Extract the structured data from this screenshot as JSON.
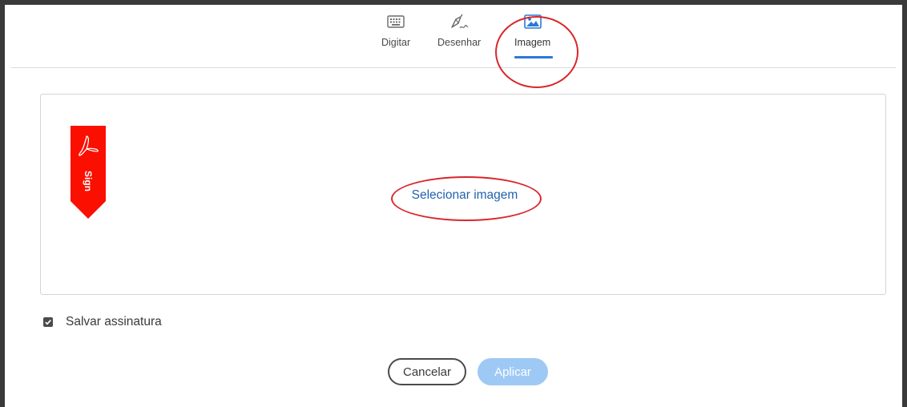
{
  "tabs": [
    {
      "label": "Digitar",
      "icon": "keyboard-icon"
    },
    {
      "label": "Desenhar",
      "icon": "pen-draw-icon"
    },
    {
      "label": "Imagem",
      "icon": "image-icon"
    }
  ],
  "active_tab": "Imagem",
  "panel": {
    "badge_text": "Sign",
    "select_image_label": "Selecionar imagem"
  },
  "save_signature": {
    "label": "Salvar assinatura",
    "checked": true
  },
  "buttons": {
    "cancel_label": "Cancelar",
    "apply_label": "Aplicar"
  },
  "colors": {
    "accent": "#2b78d8",
    "link": "#2461ad",
    "badge": "#fa0f00",
    "annotation": "#d9262b",
    "apply_disabled": "#9ec9f5"
  }
}
